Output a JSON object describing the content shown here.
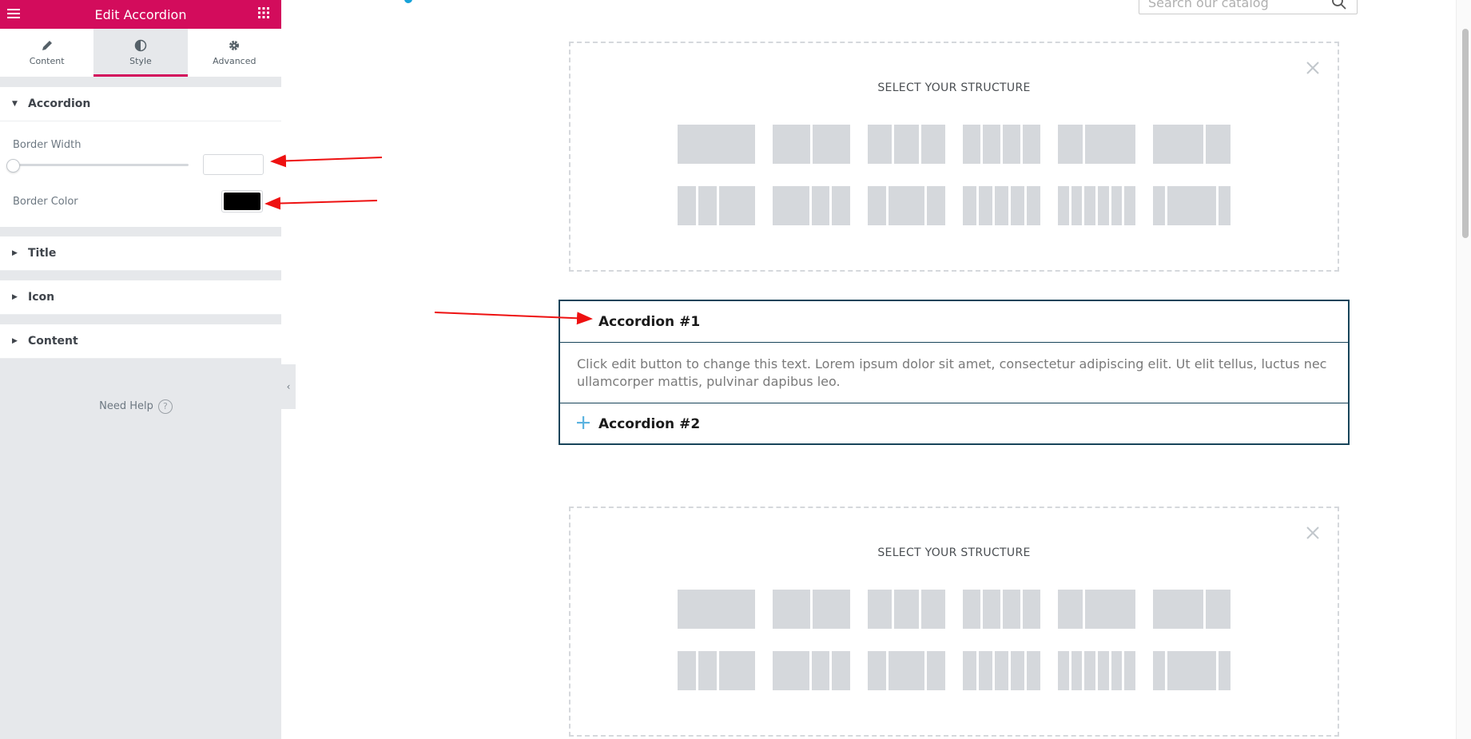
{
  "panel": {
    "title": "Edit Accordion",
    "tabs": [
      {
        "label": "Content"
      },
      {
        "label": "Style"
      },
      {
        "label": "Advanced"
      }
    ],
    "sections": {
      "accordion": {
        "label": "Accordion",
        "border_width_label": "Border Width",
        "border_width_value": "",
        "border_color_label": "Border Color",
        "border_color_value": "#000000"
      },
      "title": {
        "label": "Title"
      },
      "icon": {
        "label": "Icon"
      },
      "content": {
        "label": "Content"
      }
    },
    "need_help": "Need Help",
    "accent_color": "#d30c5c"
  },
  "preview": {
    "search_placeholder": "Search our catalog",
    "structure_title": "SELECT YOUR STRUCTURE",
    "accordion": {
      "items": [
        {
          "title": "Accordion #1",
          "content": "Click edit button to change this text. Lorem ipsum dolor sit amet, consectetur adipiscing elit. Ut elit tellus, luctus nec ullamcorper mattis, pulvinar dapibus leo."
        },
        {
          "title": "Accordion #2"
        }
      ],
      "border_color": "#17445a",
      "icon_color": "#5bb3e0"
    }
  }
}
